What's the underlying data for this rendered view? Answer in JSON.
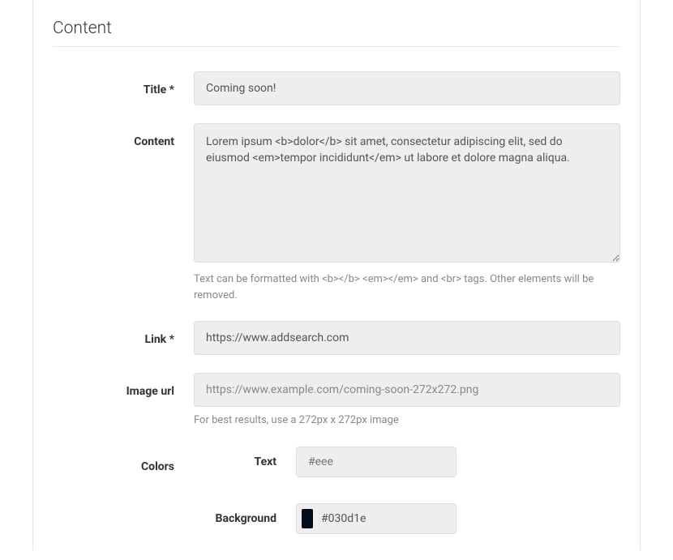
{
  "section_title": "Content",
  "fields": {
    "title": {
      "label": "Title *",
      "value": "Coming soon!"
    },
    "content": {
      "label": "Content",
      "value": "Lorem ipsum <b>dolor</b> sit amet, consectetur adipiscing elit, sed do eiusmod <em>tempor incididunt</em> ut labore et dolore magna aliqua.",
      "help": "Text can be formatted with <b></b> <em></em> and <br> tags. Other elements will be removed."
    },
    "link": {
      "label": "Link *",
      "value": "https://www.addsearch.com"
    },
    "image_url": {
      "label": "Image url",
      "placeholder": "https://www.example.com/coming-soon-272x272.png",
      "help": "For best results, use a 272px x 272px image"
    },
    "colors": {
      "label": "Colors",
      "text": {
        "label": "Text",
        "placeholder": "#eee"
      },
      "background": {
        "label": "Background",
        "value": "#030d1e",
        "swatch": "#030d1e"
      }
    }
  }
}
